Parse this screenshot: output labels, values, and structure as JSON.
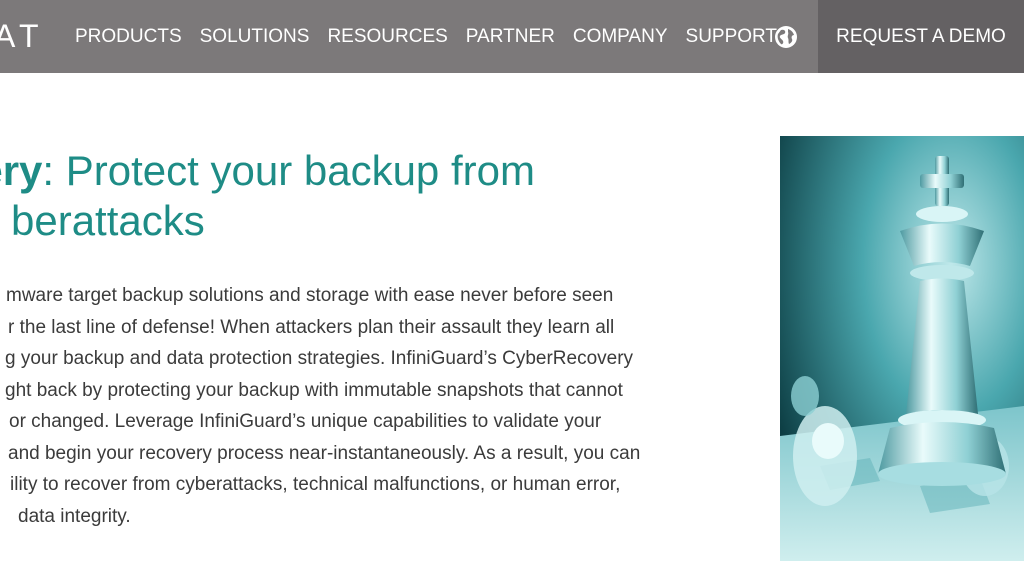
{
  "header": {
    "logo_text": "AT",
    "nav_items": [
      "PRODUCTS",
      "SOLUTIONS",
      "RESOURCES",
      "PARTNER",
      "COMPANY",
      "SUPPORT"
    ],
    "globe_icon": "globe-icon",
    "cta_label": "REQUEST A DEMO"
  },
  "hero": {
    "title_strong": "very",
    "title_rest": ": Protect your backup from",
    "title_line2": "berattacks",
    "body_lines": [
      "mware target backup solutions and storage with ease never before seen",
      "r the last line of defense! When attackers plan their assault they learn all",
      "g your backup and data protection strategies. InfiniGuard’s CyberRecovery",
      "ght back by protecting your backup with immutable snapshots that cannot",
      "or changed. Leverage InfiniGuard’s unique capabilities to validate your",
      "and begin your recovery process near-instantaneously. As a result, you can",
      "ility to recover from cyberattacks, technical malfunctions, or human error,",
      "data integrity."
    ],
    "image": "chess-king-image"
  },
  "colors": {
    "nav_bg": "#7c797a",
    "cta_bg": "#646163",
    "accent": "#1e8c86",
    "text": "#3b3b3b"
  }
}
